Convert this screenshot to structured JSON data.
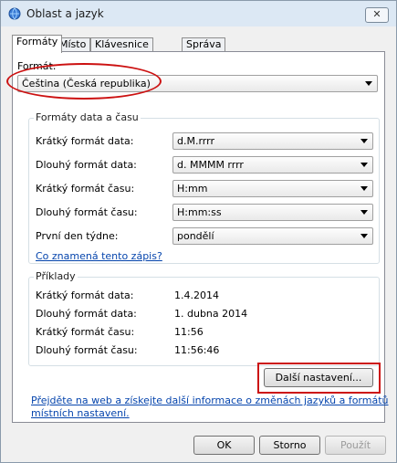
{
  "window": {
    "title": "Oblast a jazyk",
    "close_label": "✕"
  },
  "tabs": [
    {
      "label": "Formáty"
    },
    {
      "label": "Místo"
    },
    {
      "label": "Klávesnice a jazyky"
    },
    {
      "label": "Správa"
    }
  ],
  "format": {
    "label": "Formát:",
    "value": "Čeština (Česká republika)"
  },
  "datetime_group": {
    "title": "Formáty data a času",
    "rows": [
      {
        "label": "Krátký formát data:",
        "value": "d.M.rrrr"
      },
      {
        "label": "Dlouhý formát data:",
        "value": "d. MMMM rrrr"
      },
      {
        "label": "Krátký formát času:",
        "value": "H:mm"
      },
      {
        "label": "Dlouhý formát času:",
        "value": "H:mm:ss"
      },
      {
        "label": "První den týdne:",
        "value": "pondělí"
      }
    ],
    "help_link": "Co znamená tento zápis?"
  },
  "examples_group": {
    "title": "Příklady",
    "rows": [
      {
        "label": "Krátký formát data:",
        "value": "1.4.2014"
      },
      {
        "label": "Dlouhý formát data:",
        "value": "1. dubna 2014"
      },
      {
        "label": "Krátký formát času:",
        "value": "11:56"
      },
      {
        "label": "Dlouhý formát času:",
        "value": "11:56:46"
      }
    ]
  },
  "more_settings_button": "Další nastavení...",
  "web_link": {
    "line1": "Přejděte na web a získejte další informace o změnách jazyků a formátů",
    "line2": "místních nastavení."
  },
  "footer": {
    "ok": "OK",
    "cancel": "Storno",
    "apply": "Použít"
  },
  "colors": {
    "highlight": "#cc1111",
    "link": "#0645ad"
  }
}
